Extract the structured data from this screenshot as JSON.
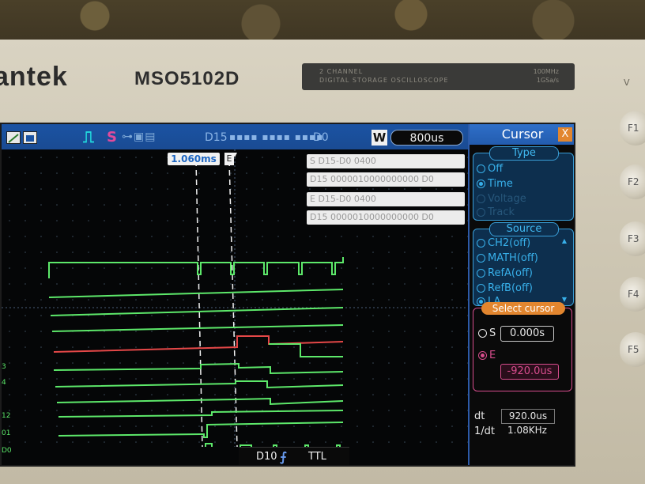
{
  "device": {
    "brand": "antek",
    "model": "MSO5102D",
    "plate_line1": "2 CHANNEL",
    "plate_line2": "DIGITAL STORAGE OSCILLOSCOPE",
    "plate_right1": "100MHz",
    "plate_right2": "1GSa/s"
  },
  "softkeys": [
    "F1",
    "F2",
    "F3",
    "F4",
    "F5"
  ],
  "topbar": {
    "bus_left": "D15",
    "bus_dots": "▪▪▪▪ ▪▪▪▪ ▪▪▪▪",
    "bus_right": "D0",
    "w_label": "W",
    "timebase": "800us"
  },
  "cursor_readout": "1.060ms",
  "e_marker": "E",
  "data_boxes": [
    "S D15-D0  0400",
    "D15 0000010000000000 D0",
    "E D15-D0  0400",
    "D15 0000010000000000 D0"
  ],
  "trigger": {
    "source": "D10",
    "edge_icon": "rising-edge-icon",
    "level": "TTL"
  },
  "menu": {
    "title": "Cursor",
    "close_label": "X",
    "type": {
      "heading": "Type",
      "options": [
        {
          "label": "Off",
          "selected": false,
          "dim": false
        },
        {
          "label": "Time",
          "selected": true,
          "dim": false
        },
        {
          "label": "Voltage",
          "selected": false,
          "dim": true
        },
        {
          "label": "Track",
          "selected": false,
          "dim": true
        }
      ]
    },
    "source": {
      "heading": "Source",
      "options": [
        {
          "label": "CH2(off)",
          "selected": false
        },
        {
          "label": "MATH(off)",
          "selected": false
        },
        {
          "label": "RefA(off)",
          "selected": false
        },
        {
          "label": "RefB(off)",
          "selected": false
        },
        {
          "label": "LA",
          "selected": true
        }
      ]
    },
    "select_cursor": {
      "heading": "Select cursor",
      "s_label": "S",
      "s_value": "0.000s",
      "e_label": "E",
      "e_value": "-920.0us"
    },
    "dt": {
      "label": "dt",
      "value": "920.0us"
    },
    "inv_dt": {
      "label": "1/dt",
      "value": "1.08KHz"
    }
  },
  "channel_labels": [
    "3",
    "4",
    "12",
    "01",
    "D0"
  ],
  "colors": {
    "trace": "#5de86a",
    "highlight_trace": "#e54848",
    "menu_accent": "#3a9fd8",
    "select_accent": "#d74d8d",
    "topbar": "#1b53a3"
  }
}
